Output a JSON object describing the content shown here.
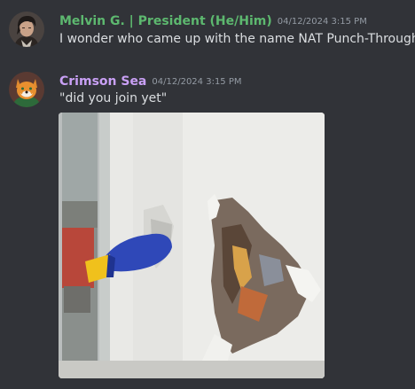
{
  "messages": [
    {
      "username": "Melvin G. | President (He/Him)",
      "timestamp": "04/12/2024 3:15 PM",
      "text": "I wonder who came up with the name NAT Punch-Through",
      "name_color": "#5db86f",
      "avatar_icon": "user-avatar-dark-hair"
    },
    {
      "username": "Crimson Sea",
      "timestamp": "04/12/2024 3:15 PM",
      "text": "\"did you join yet\"",
      "name_color": "#c9a0f5",
      "avatar_icon": "fox-pilot-avatar",
      "attachment": {
        "type": "image",
        "icon": "gif-attachment-wall-punch"
      }
    }
  ],
  "colors": {
    "background": "#313338",
    "text": "#dbdee1",
    "timestamp": "#949ba4"
  }
}
